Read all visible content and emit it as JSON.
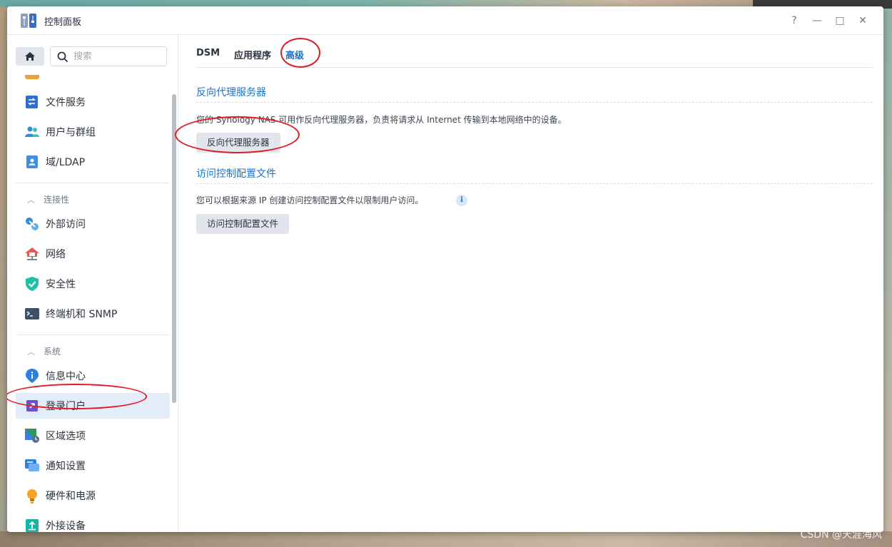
{
  "window": {
    "title": "控制面板",
    "help": "?",
    "minimize": "—",
    "maximize": "□",
    "close": "✕"
  },
  "sidebar": {
    "search_placeholder": "搜索",
    "items_top": [
      {
        "label": "文件服务",
        "icon": "file-services-icon"
      },
      {
        "label": "用户与群组",
        "icon": "user-group-icon"
      },
      {
        "label": "域/LDAP",
        "icon": "domain-ldap-icon"
      }
    ],
    "section_connectivity": "连接性",
    "items_connectivity": [
      {
        "label": "外部访问",
        "icon": "external-access-icon"
      },
      {
        "label": "网络",
        "icon": "network-icon"
      },
      {
        "label": "安全性",
        "icon": "security-shield-icon"
      },
      {
        "label": "终端机和 SNMP",
        "icon": "terminal-icon"
      }
    ],
    "section_system": "系统",
    "items_system": [
      {
        "label": "信息中心",
        "icon": "info-center-icon"
      },
      {
        "label": "登录门户",
        "icon": "login-portal-icon",
        "active": true
      },
      {
        "label": "区域选项",
        "icon": "regional-options-icon"
      },
      {
        "label": "通知设置",
        "icon": "notification-icon"
      },
      {
        "label": "硬件和电源",
        "icon": "hardware-power-icon"
      },
      {
        "label": "外接设备",
        "icon": "external-devices-icon"
      }
    ]
  },
  "tabs": [
    {
      "label": "DSM"
    },
    {
      "label": "应用程序"
    },
    {
      "label": "高级",
      "active": true
    }
  ],
  "reverse_proxy": {
    "title": "反向代理服务器",
    "description": "您的 Synology NAS 可用作反向代理服务器，负责将请求从 Internet 传输到本地网络中的设备。",
    "button": "反向代理服务器"
  },
  "access_control": {
    "title": "访问控制配置文件",
    "description": "您可以根据来源 IP 创建访问控制配置文件以限制用户访问。",
    "info": "i",
    "button": "访问控制配置文件"
  },
  "watermark": "CSDN @天涯海风",
  "colors": {
    "accent": "#1a73c8",
    "annotation": "#e01b24",
    "active_bg": "#e3edf9"
  }
}
